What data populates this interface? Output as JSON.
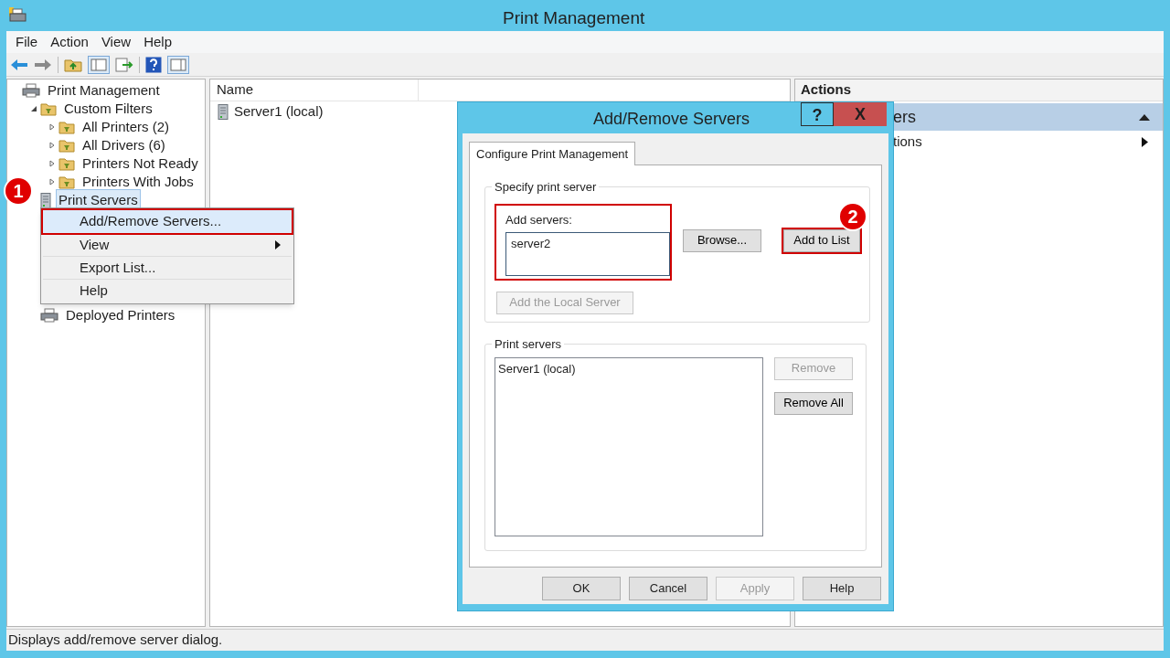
{
  "window": {
    "title": "Print Management"
  },
  "menu": [
    "File",
    "Action",
    "View",
    "Help"
  ],
  "tree": [
    {
      "label": "Print Management",
      "kind": "printer",
      "selected": false,
      "children": [
        {
          "label": "Custom Filters",
          "kind": "folder",
          "expanded": true,
          "selected": false,
          "children": [
            {
              "label": "All Printers (2)",
              "kind": "folder",
              "expanded": false,
              "selected": false
            },
            {
              "label": "All Drivers (6)",
              "kind": "folder",
              "expanded": false,
              "selected": false
            },
            {
              "label": "Printers Not Ready",
              "kind": "folder",
              "expanded": false,
              "selected": false
            },
            {
              "label": "Printers With Jobs",
              "kind": "folder",
              "expanded": false,
              "selected": false
            }
          ]
        },
        {
          "label": "Print Servers",
          "kind": "server",
          "selected": true,
          "callout": "1"
        },
        {
          "label": "Deployed Printers",
          "kind": "printer",
          "selected": false
        }
      ]
    }
  ],
  "list": {
    "columns": [
      "Name"
    ],
    "rows": [
      "Server1 (local)"
    ]
  },
  "actions": {
    "header": "Actions",
    "section": "ers",
    "item": "tions"
  },
  "context_menu": [
    {
      "label": "Add/Remove Servers...",
      "selected": true,
      "highlighted": true,
      "submenu": false
    },
    {
      "label": "View",
      "selected": false,
      "highlighted": false,
      "submenu": true
    },
    {
      "label": "Export List...",
      "selected": false,
      "highlighted": false,
      "submenu": false
    },
    {
      "label": "Help",
      "selected": false,
      "highlighted": false,
      "submenu": false
    }
  ],
  "dialog": {
    "title": "Add/Remove Servers",
    "help": "?",
    "close": "X",
    "tab": "Configure Print Management",
    "specify_group": "Specify print server",
    "add_label": "Add servers:",
    "add_value": "server2",
    "add_highlighted": true,
    "browse": {
      "label": "Browse...",
      "disabled": false,
      "highlighted": false
    },
    "add_to_list": {
      "label": "Add to List",
      "disabled": false,
      "highlighted": true,
      "callout": "2"
    },
    "add_local": {
      "label": "Add the Local Server",
      "disabled": true,
      "highlighted": false
    },
    "servers_group": "Print servers",
    "servers": [
      "Server1 (local)"
    ],
    "remove": {
      "label": "Remove",
      "disabled": true,
      "highlighted": false
    },
    "remove_all": {
      "label": "Remove All",
      "disabled": false,
      "highlighted": false
    },
    "footer": [
      {
        "label": "OK",
        "disabled": false
      },
      {
        "label": "Cancel",
        "disabled": false
      },
      {
        "label": "Apply",
        "disabled": true
      },
      {
        "label": "Help",
        "disabled": false
      }
    ]
  },
  "status_bar": "Displays add/remove server dialog."
}
